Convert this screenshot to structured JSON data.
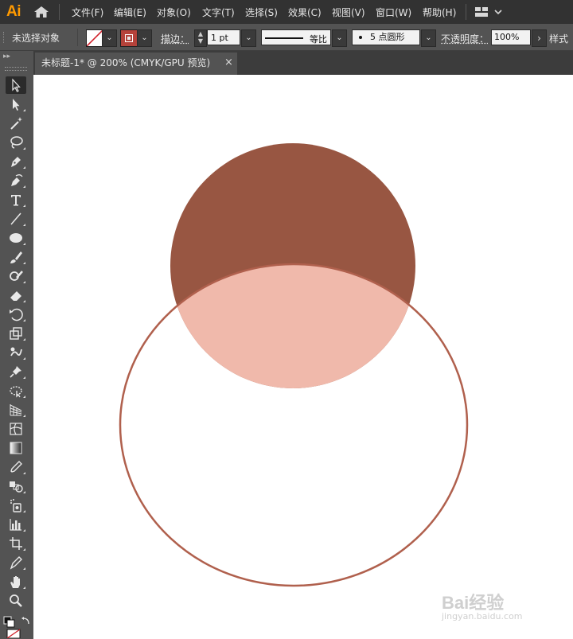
{
  "app": {
    "logo": "Ai"
  },
  "menu": [
    "文件(F)",
    "编辑(E)",
    "对象(O)",
    "文字(T)",
    "选择(S)",
    "效果(C)",
    "视图(V)",
    "窗口(W)",
    "帮助(H)"
  ],
  "control": {
    "selection_status": "未选择对象",
    "stroke_label": "描边：",
    "stroke_weight": "1 pt",
    "profile_label": "等比",
    "brush_dot": "5",
    "brush_label": "点圆形",
    "opacity_label": "不透明度：",
    "opacity_value": "100%",
    "style_label": "样式"
  },
  "tab": {
    "title": "未标题-1* @ 200% (CMYK/GPU 预览)",
    "close": "×"
  },
  "tools": [
    "selection-tool",
    "direct-selection-tool",
    "magic-wand-tool",
    "lasso-tool",
    "pen-tool",
    "curvature-tool",
    "type-tool",
    "line-tool",
    "ellipse-tool",
    "paintbrush-tool",
    "shaper-tool",
    "eraser-tool",
    "rotate-tool",
    "scale-tool",
    "warp-tool",
    "pin-tool",
    "free-transform-tool",
    "perspective-grid-tool",
    "mesh-tool",
    "gradient-tool",
    "eyedropper-tool",
    "blend-tool",
    "symbol-sprayer-tool",
    "column-graph-tool",
    "artboard-tool",
    "slice-tool",
    "hand-tool",
    "zoom-tool"
  ],
  "colors": {
    "brown_circle": "#985642",
    "intersection": "#f0b9ab",
    "outline": "#b0604d",
    "stroke_swatch": "#b5423a",
    "logo": "#ff9a00"
  },
  "watermark": {
    "main": "Bai经验",
    "sub": "jingyan.baidu.com"
  }
}
